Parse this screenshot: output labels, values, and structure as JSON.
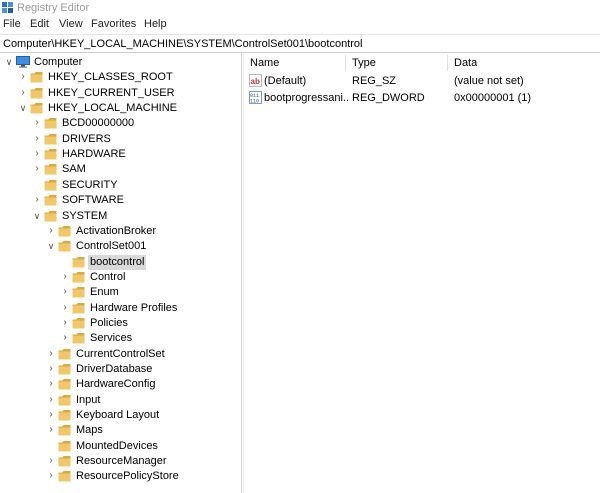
{
  "window": {
    "title": "Registry Editor"
  },
  "menu": [
    "File",
    "Edit",
    "View",
    "Favorites",
    "Help"
  ],
  "address": "Computer\\HKEY_LOCAL_MACHINE\\SYSTEM\\ControlSet001\\bootcontrol",
  "tree": [
    {
      "label": "Computer",
      "level": 0,
      "expand": "down",
      "kind": "computer",
      "name": "computer"
    },
    {
      "label": "HKEY_CLASSES_ROOT",
      "level": 1,
      "expand": "right",
      "kind": "folder",
      "name": "hkey-classes-root"
    },
    {
      "label": "HKEY_CURRENT_USER",
      "level": 1,
      "expand": "right",
      "kind": "folder",
      "name": "hkey-current-user"
    },
    {
      "label": "HKEY_LOCAL_MACHINE",
      "level": 1,
      "expand": "down",
      "kind": "folder",
      "name": "hkey-local-machine"
    },
    {
      "label": "BCD00000000",
      "level": 2,
      "expand": "right",
      "kind": "folder",
      "name": "bcd00000000"
    },
    {
      "label": "DRIVERS",
      "level": 2,
      "expand": "right",
      "kind": "folder",
      "name": "drivers"
    },
    {
      "label": "HARDWARE",
      "level": 2,
      "expand": "right",
      "kind": "folder",
      "name": "hardware"
    },
    {
      "label": "SAM",
      "level": 2,
      "expand": "right",
      "kind": "folder",
      "name": "sam"
    },
    {
      "label": "SECURITY",
      "level": 2,
      "expand": "none",
      "kind": "folder",
      "name": "security"
    },
    {
      "label": "SOFTWARE",
      "level": 2,
      "expand": "right",
      "kind": "folder",
      "name": "software"
    },
    {
      "label": "SYSTEM",
      "level": 2,
      "expand": "down",
      "kind": "folder",
      "name": "system"
    },
    {
      "label": "ActivationBroker",
      "level": 3,
      "expand": "right",
      "kind": "folder",
      "name": "activationbroker"
    },
    {
      "label": "ControlSet001",
      "level": 3,
      "expand": "down",
      "kind": "folder",
      "name": "controlset001"
    },
    {
      "label": "bootcontrol",
      "level": 4,
      "expand": "none",
      "kind": "folder",
      "name": "bootcontrol",
      "selected": true
    },
    {
      "label": "Control",
      "level": 4,
      "expand": "right",
      "kind": "folder",
      "name": "control"
    },
    {
      "label": "Enum",
      "level": 4,
      "expand": "right",
      "kind": "folder",
      "name": "enum"
    },
    {
      "label": "Hardware Profiles",
      "level": 4,
      "expand": "right",
      "kind": "folder",
      "name": "hardware-profiles"
    },
    {
      "label": "Policies",
      "level": 4,
      "expand": "right",
      "kind": "folder",
      "name": "policies"
    },
    {
      "label": "Services",
      "level": 4,
      "expand": "right",
      "kind": "folder",
      "name": "services"
    },
    {
      "label": "CurrentControlSet",
      "level": 3,
      "expand": "right",
      "kind": "folder",
      "name": "currentcontrolset"
    },
    {
      "label": "DriverDatabase",
      "level": 3,
      "expand": "right",
      "kind": "folder",
      "name": "driverdatabase"
    },
    {
      "label": "HardwareConfig",
      "level": 3,
      "expand": "right",
      "kind": "folder",
      "name": "hardwareconfig"
    },
    {
      "label": "Input",
      "level": 3,
      "expand": "right",
      "kind": "folder",
      "name": "input"
    },
    {
      "label": "Keyboard Layout",
      "level": 3,
      "expand": "right",
      "kind": "folder",
      "name": "keyboard-layout"
    },
    {
      "label": "Maps",
      "level": 3,
      "expand": "right",
      "kind": "folder",
      "name": "maps"
    },
    {
      "label": "MountedDevices",
      "level": 3,
      "expand": "none",
      "kind": "folder",
      "name": "mounteddevices"
    },
    {
      "label": "ResourceManager",
      "level": 3,
      "expand": "right",
      "kind": "folder",
      "name": "resourcemanager"
    },
    {
      "label": "ResourcePolicyStore",
      "level": 3,
      "expand": "right",
      "kind": "folder",
      "name": "resourcepolicystore"
    }
  ],
  "columns": {
    "name": "Name",
    "type": "Type",
    "data": "Data"
  },
  "values": [
    {
      "icon": "string-value-icon",
      "name": "(Default)",
      "type": "REG_SZ",
      "data": "(value not set)"
    },
    {
      "icon": "dword-value-icon",
      "name": "bootprogressani...",
      "type": "REG_DWORD",
      "data": "0x00000001 (1)"
    }
  ],
  "colors": {
    "folder": "#f2c766",
    "folder_dark": "#dcaa3c",
    "selection": "#d9d9d9"
  }
}
